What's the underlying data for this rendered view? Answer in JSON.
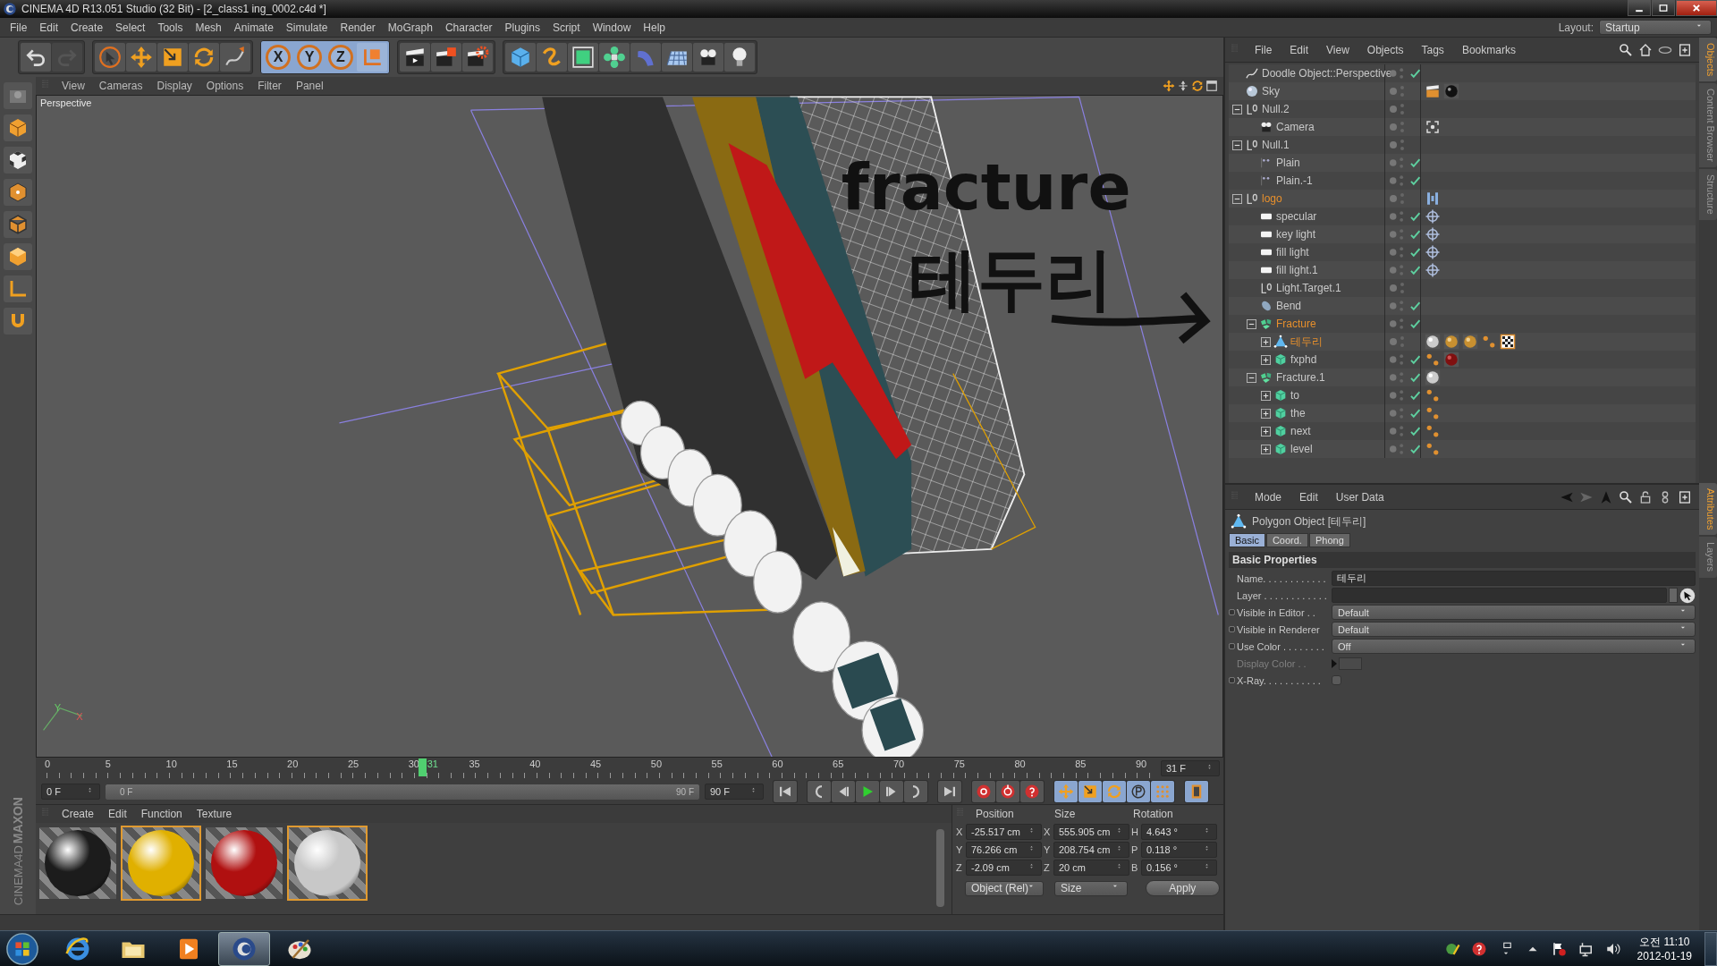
{
  "window": {
    "title": "CINEMA 4D R13.051 Studio (32 Bit) - [2_class1 ing_0002.c4d *]"
  },
  "menu": [
    "File",
    "Edit",
    "Create",
    "Select",
    "Tools",
    "Mesh",
    "Animate",
    "Simulate",
    "Render",
    "MoGraph",
    "Character",
    "Plugins",
    "Script",
    "Window",
    "Help"
  ],
  "layout": {
    "label": "Layout:",
    "value": "Startup"
  },
  "toolbar": [
    {
      "highlighted": false,
      "items": [
        {
          "kind": "undo",
          "disabled": false
        },
        {
          "kind": "redo",
          "disabled": true
        }
      ]
    },
    {
      "highlighted": false,
      "items": [
        {
          "kind": "pointer",
          "disabled": false
        },
        {
          "kind": "move",
          "disabled": false
        },
        {
          "kind": "scale",
          "disabled": false
        },
        {
          "kind": "rotate",
          "disabled": false
        },
        {
          "kind": "pen",
          "disabled": false
        }
      ]
    },
    {
      "highlighted": true,
      "items": [
        {
          "kind": "axis",
          "label": "X",
          "disabled": false
        },
        {
          "kind": "axis",
          "label": "Y",
          "disabled": false
        },
        {
          "kind": "axis",
          "label": "Z",
          "disabled": false
        },
        {
          "kind": "coords",
          "disabled": false
        }
      ]
    },
    {
      "highlighted": false,
      "items": [
        {
          "kind": "render-view",
          "disabled": false
        },
        {
          "kind": "render-picture",
          "disabled": false
        },
        {
          "kind": "render-settings",
          "disabled": false
        }
      ]
    },
    {
      "highlighted": false,
      "items": [
        {
          "kind": "cube",
          "disabled": false
        },
        {
          "kind": "spline",
          "disabled": false
        },
        {
          "kind": "nurbs",
          "disabled": false
        },
        {
          "kind": "cloner",
          "disabled": false
        },
        {
          "kind": "bend",
          "disabled": false
        },
        {
          "kind": "floor",
          "disabled": false
        },
        {
          "kind": "camera",
          "disabled": false
        },
        {
          "kind": "light",
          "disabled": false
        }
      ]
    }
  ],
  "left_tools": [
    {
      "kind": "workplane"
    },
    {
      "kind": "model"
    },
    {
      "kind": "texture"
    },
    {
      "kind": "points"
    },
    {
      "kind": "edges"
    },
    {
      "kind": "polygons"
    },
    {
      "kind": "axis-mode"
    },
    {
      "kind": "magnet"
    }
  ],
  "viewport": {
    "menu": [
      "View",
      "Cameras",
      "Display",
      "Options",
      "Filter",
      "Panel"
    ],
    "camera_label": "Perspective",
    "doodle": [
      "fracture",
      "테두리"
    ],
    "axis_labels": [
      "Y",
      "X"
    ]
  },
  "timeline": {
    "ticks": [
      "0",
      "5",
      "10",
      "15",
      "20",
      "25",
      "30",
      "35",
      "40",
      "45",
      "50",
      "55",
      "60",
      "65",
      "70",
      "75",
      "80",
      "85",
      "90"
    ],
    "current": "31",
    "playhead": {
      "level": 0.344
    },
    "current_field": "31 F",
    "start_field": "0 F",
    "range": {
      "start": "0 F",
      "end": "90 F",
      "level": 1
    },
    "end_field": "90 F",
    "playback": [
      {
        "kind": "first"
      },
      {
        "kind": "prev-key"
      },
      {
        "kind": "step-back"
      },
      {
        "kind": "play"
      },
      {
        "kind": "step-fwd"
      },
      {
        "kind": "next-key"
      },
      {
        "kind": "last"
      }
    ],
    "record": [
      {
        "kind": "record"
      },
      {
        "kind": "autokey"
      },
      {
        "kind": "help"
      }
    ],
    "keymodes": [
      {
        "kind": "move"
      },
      {
        "kind": "scale"
      },
      {
        "kind": "rotate"
      },
      {
        "kind": "param"
      },
      {
        "kind": "grid"
      }
    ],
    "film": {
      "kind": "film"
    }
  },
  "materials": {
    "menu": [
      "Create",
      "Edit",
      "Function",
      "Texture"
    ],
    "items": [
      {
        "color": "#1c1c1c",
        "selected": false
      },
      {
        "color": "#e0b000",
        "selected": true
      },
      {
        "color": "#b01010",
        "selected": false
      },
      {
        "color": "#c8c8c8",
        "selected": true
      }
    ]
  },
  "brand": [
    "MAXON",
    "CINEMA4D"
  ],
  "coordinates": {
    "headers": [
      "Position",
      "Size",
      "Rotation"
    ],
    "rows": [
      [
        {
          "axis": "X",
          "value": "-25.517 cm"
        },
        {
          "axis": "X",
          "value": "555.905 cm"
        },
        {
          "axis": "H",
          "value": "4.643 °"
        }
      ],
      [
        {
          "axis": "Y",
          "value": "76.266 cm"
        },
        {
          "axis": "Y",
          "value": "208.754 cm"
        },
        {
          "axis": "P",
          "value": "0.118 °"
        }
      ],
      [
        {
          "axis": "Z",
          "value": "-2.09 cm"
        },
        {
          "axis": "Z",
          "value": "20 cm"
        },
        {
          "axis": "B",
          "value": "0.156 °"
        }
      ]
    ],
    "mode": "Object (Rel)",
    "size_mode": "Size",
    "apply": "Apply"
  },
  "objects": {
    "menu": [
      "File",
      "Edit",
      "View",
      "Objects",
      "Tags",
      "Bookmarks"
    ],
    "tree": [
      {
        "name": "Doodle Object::Perspective",
        "kind": "doodle",
        "selected": false,
        "checked": true
      },
      {
        "name": "Sky",
        "kind": "sky",
        "selected": false,
        "checked": false,
        "tags": [
          {
            "kind": "scene"
          },
          {
            "kind": "material-black"
          }
        ]
      },
      {
        "name": "Null.2",
        "kind": "null",
        "selected": false,
        "checked": false,
        "expanded": true,
        "children": [
          {
            "name": "Camera",
            "kind": "camera",
            "selected": false,
            "checked": false,
            "tags": [
              {
                "kind": "focus"
              }
            ]
          }
        ]
      },
      {
        "name": "Null.1",
        "kind": "null",
        "selected": false,
        "checked": false,
        "expanded": true,
        "children": [
          {
            "name": "Plain",
            "kind": "plain",
            "selected": false,
            "checked": true
          },
          {
            "name": "Plain.-1",
            "kind": "plain",
            "selected": false,
            "checked": true
          }
        ]
      },
      {
        "name": "logo",
        "kind": "null",
        "selected": true,
        "checked": false,
        "tags": [
          {
            "kind": "protection"
          }
        ],
        "expanded": true,
        "children": [
          {
            "name": "specular",
            "kind": "light",
            "selected": false,
            "checked": true,
            "tags": [
              {
                "kind": "target"
              }
            ]
          },
          {
            "name": "key light",
            "kind": "light",
            "selected": false,
            "checked": true,
            "tags": [
              {
                "kind": "target"
              }
            ]
          },
          {
            "name": "fill light",
            "kind": "light",
            "selected": false,
            "checked": true,
            "tags": [
              {
                "kind": "target"
              }
            ]
          },
          {
            "name": "fill light.1",
            "kind": "light",
            "selected": false,
            "checked": true,
            "tags": [
              {
                "kind": "target"
              }
            ]
          },
          {
            "name": "Light.Target.1",
            "kind": "null",
            "selected": false,
            "checked": false
          },
          {
            "name": "Bend",
            "kind": "bend",
            "selected": false,
            "checked": true
          },
          {
            "name": "Fracture",
            "kind": "fracture",
            "selected": true,
            "checked": true,
            "expanded": true,
            "children": [
              {
                "name": "테두리",
                "kind": "polygon",
                "selected": true,
                "checked": false,
                "tags": [
                  {
                    "kind": "material-white"
                  },
                  {
                    "kind": "material-gold"
                  },
                  {
                    "kind": "material-gold"
                  },
                  {
                    "kind": "selection"
                  },
                  {
                    "kind": "checker"
                  }
                ],
                "expanded": false
              },
              {
                "name": "fxphd",
                "kind": "extrude",
                "selected": false,
                "checked": true,
                "tags": [
                  {
                    "kind": "selection"
                  },
                  {
                    "kind": "material-red"
                  }
                ],
                "expanded": false
              }
            ]
          },
          {
            "name": "Fracture.1",
            "kind": "fracture",
            "selected": false,
            "checked": true,
            "tags": [
              {
                "kind": "material-white"
              }
            ],
            "expanded": true,
            "children": [
              {
                "name": "to",
                "kind": "extrude",
                "selected": false,
                "checked": true,
                "tags": [
                  {
                    "kind": "selection"
                  }
                ],
                "expanded": false
              },
              {
                "name": "the",
                "kind": "extrude",
                "selected": false,
                "checked": true,
                "tags": [
                  {
                    "kind": "selection"
                  }
                ],
                "expanded": false
              },
              {
                "name": "next",
                "kind": "extrude",
                "selected": false,
                "checked": true,
                "tags": [
                  {
                    "kind": "selection"
                  }
                ],
                "expanded": false
              },
              {
                "name": "level",
                "kind": "extrude",
                "selected": false,
                "checked": true,
                "tags": [
                  {
                    "kind": "selection"
                  }
                ],
                "expanded": false
              }
            ]
          }
        ]
      }
    ]
  },
  "attributes": {
    "menu": [
      "Mode",
      "Edit",
      "User Data"
    ],
    "title": "Polygon Object [테두리]",
    "tabs": [
      {
        "label": "Basic",
        "selected": true
      },
      {
        "label": "Coord.",
        "selected": false
      },
      {
        "label": "Phong",
        "selected": false
      }
    ],
    "section": "Basic Properties",
    "fields": [
      {
        "kind": "text",
        "label": "Name. . . . . . . . . . . .",
        "value": "테두리",
        "animatable": false,
        "disabled": false
      },
      {
        "kind": "layer",
        "label": "Layer . . . . . . . . . . . .",
        "animatable": false,
        "disabled": false
      },
      {
        "kind": "dropdown",
        "label": "Visible in Editor . .",
        "value": "Default",
        "animatable": true,
        "disabled": false
      },
      {
        "kind": "dropdown",
        "label": "Visible in Renderer",
        "value": "Default",
        "animatable": true,
        "disabled": false
      },
      {
        "kind": "dropdown",
        "label": "Use Color . . . . . . . .",
        "value": "Off",
        "animatable": true,
        "disabled": false
      },
      {
        "kind": "color",
        "label": "Display Color . .",
        "animatable": false,
        "disabled": true
      },
      {
        "kind": "checkbox",
        "label": "X-Ray. . . . . . . . . . .",
        "checked": false,
        "animatable": true,
        "disabled": false
      }
    ]
  },
  "side_tabs": {
    "top": [
      {
        "label": "Objects",
        "selected": true
      },
      {
        "label": "Content Browser",
        "selected": false
      },
      {
        "label": "Structure",
        "selected": false
      }
    ],
    "bottom": [
      {
        "label": "Attributes",
        "selected": true
      },
      {
        "label": "Layers",
        "selected": false
      }
    ]
  },
  "taskbar": {
    "apps": [
      {
        "kind": "browser",
        "selected": false
      },
      {
        "kind": "folder",
        "selected": false
      },
      {
        "kind": "media",
        "selected": false
      },
      {
        "kind": "c4d",
        "selected": true
      },
      {
        "kind": "paint",
        "selected": false
      }
    ],
    "time": "오전 11:10",
    "date": "2012-01-19"
  }
}
